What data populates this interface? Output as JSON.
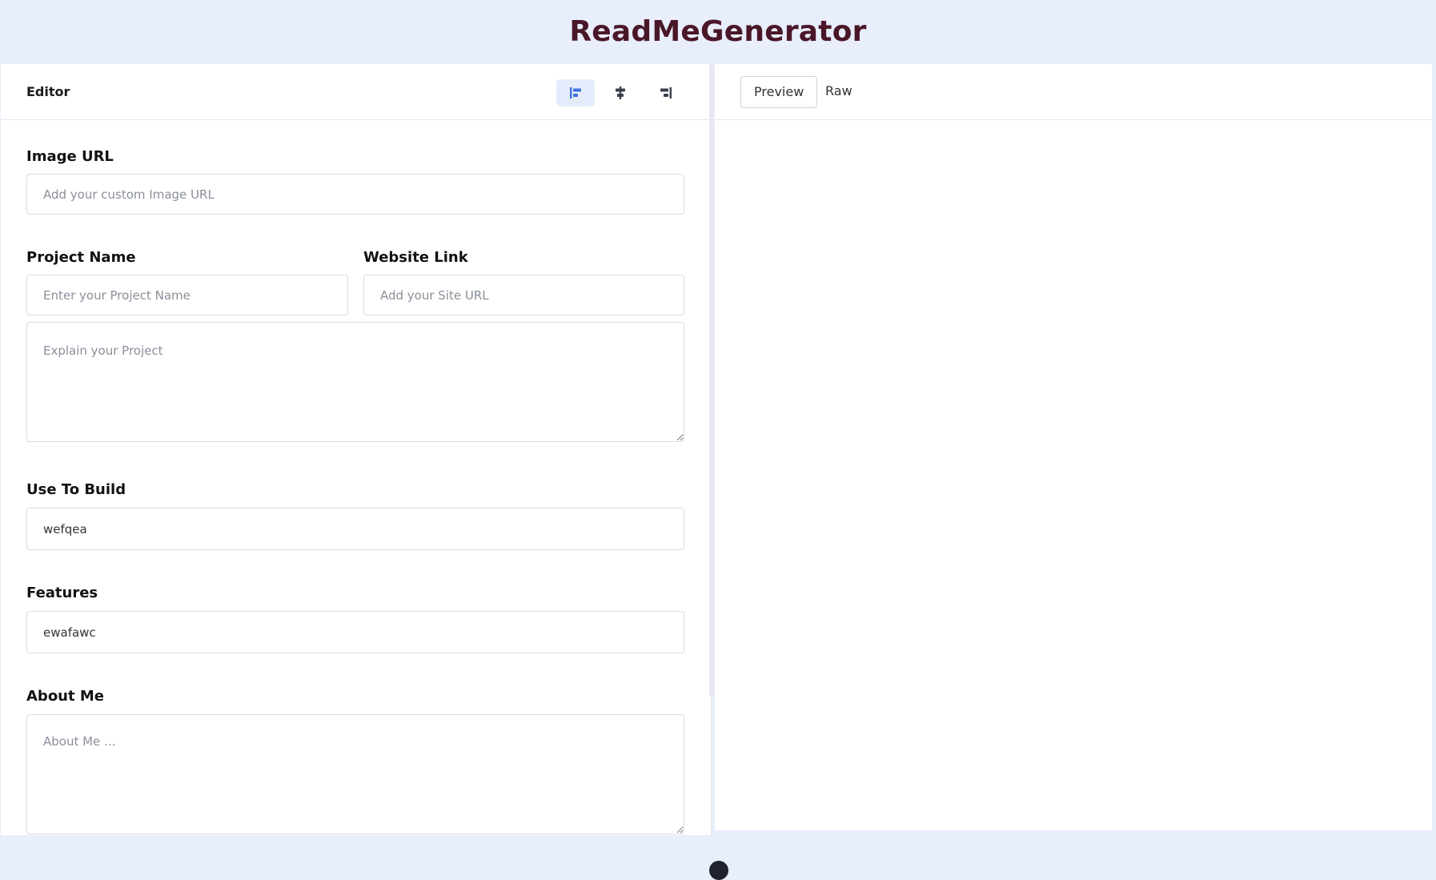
{
  "app": {
    "title": "ReadMeGenerator"
  },
  "editor": {
    "title": "Editor",
    "align_buttons": [
      "align-left-icon",
      "align-center-icon",
      "align-right-icon"
    ],
    "active_align": "align-left",
    "fields": {
      "image_url": {
        "label": "Image URL",
        "placeholder": "Add your custom Image URL",
        "value": ""
      },
      "project_name": {
        "label": "Project Name",
        "placeholder": "Enter your Project Name",
        "value": ""
      },
      "website_link": {
        "label": "Website Link",
        "placeholder": "Add your Site URL",
        "value": ""
      },
      "description": {
        "placeholder": "Explain your Project",
        "value": ""
      },
      "use_to_build": {
        "label": "Use To Build",
        "value": "wefqea"
      },
      "features": {
        "label": "Features",
        "value": "ewafawc"
      },
      "about_me": {
        "label": "About Me",
        "placeholder": "About Me ...",
        "value": ""
      }
    }
  },
  "preview": {
    "tabs": [
      {
        "label": "Preview",
        "active": true
      },
      {
        "label": "Raw",
        "active": false
      }
    ]
  },
  "colors": {
    "page_bg": "#e8eefc",
    "title": "#4a1728",
    "accent": "#3b6fe0",
    "accent_bg": "#e4ecfc"
  }
}
